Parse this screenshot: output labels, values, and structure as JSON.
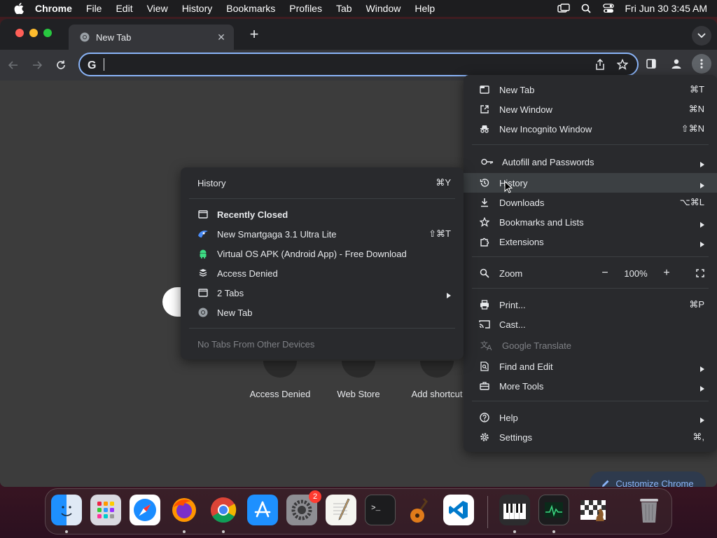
{
  "menubar": {
    "app": "Chrome",
    "items": [
      "File",
      "Edit",
      "View",
      "History",
      "Bookmarks",
      "Profiles",
      "Tab",
      "Window",
      "Help"
    ],
    "clock": "Fri Jun 30  3:45 AM"
  },
  "browser": {
    "tab_title": "New Tab",
    "omnibox_value": "",
    "shortcuts": [
      {
        "label": "Access Denied"
      },
      {
        "label": "Web Store"
      },
      {
        "label": "Add shortcut"
      }
    ],
    "customize_label": "Customize Chrome"
  },
  "main_menu": {
    "items": [
      {
        "label": "New Tab",
        "shortcut": "⌘T",
        "icon": "new-tab-icon"
      },
      {
        "label": "New Window",
        "shortcut": "⌘N",
        "icon": "new-window-icon"
      },
      {
        "label": "New Incognito Window",
        "shortcut": "⇧⌘N",
        "icon": "incognito-icon"
      },
      {
        "label": "Autofill and Passwords",
        "icon": "key-icon",
        "submenu": true
      },
      {
        "label": "History",
        "icon": "history-icon",
        "submenu": true,
        "highlighted": true
      },
      {
        "label": "Downloads",
        "shortcut": "⌥⌘L",
        "icon": "download-icon"
      },
      {
        "label": "Bookmarks and Lists",
        "icon": "star-icon",
        "submenu": true
      },
      {
        "label": "Extensions",
        "icon": "extension-icon",
        "submenu": true
      },
      {
        "label": "Zoom",
        "icon": "zoom-icon"
      },
      {
        "label": "Print...",
        "shortcut": "⌘P",
        "icon": "print-icon"
      },
      {
        "label": "Cast...",
        "icon": "cast-icon"
      },
      {
        "label": "Google Translate",
        "icon": "translate-icon",
        "disabled": true
      },
      {
        "label": "Find and Edit",
        "icon": "find-icon",
        "submenu": true
      },
      {
        "label": "More Tools",
        "icon": "toolbox-icon",
        "submenu": true
      },
      {
        "label": "Help",
        "icon": "help-icon",
        "submenu": true
      },
      {
        "label": "Settings",
        "shortcut": "⌘,",
        "icon": "settings-icon"
      }
    ],
    "zoom": {
      "minus": "−",
      "value": "100%",
      "plus": "+"
    }
  },
  "history_menu": {
    "header": {
      "label": "History",
      "shortcut": "⌘Y"
    },
    "recently_closed_label": "Recently Closed",
    "entries": [
      {
        "label": "New Smartgaga 3.1 Ultra Lite",
        "shortcut": "⇧⌘T",
        "icon": "smartgaga-icon"
      },
      {
        "label": "Virtual OS APK (Android App) - Free Download",
        "icon": "android-icon"
      },
      {
        "label": "Access Denied",
        "icon": "page-icon"
      },
      {
        "label": "2 Tabs",
        "icon": "window-icon",
        "submenu": true
      },
      {
        "label": "New Tab",
        "icon": "chrome-icon"
      }
    ],
    "footer": "No Tabs From Other Devices"
  },
  "dock": {
    "apps": [
      "Finder",
      "Launchpad",
      "Safari",
      "Firefox",
      "Chrome",
      "App Store",
      "System Settings",
      "TextEdit",
      "Terminal",
      "GarageBand",
      "VS Code",
      "Piano",
      "Activity Monitor",
      "Chess",
      "Trash"
    ],
    "settings_badge": "2"
  },
  "colors": {
    "menu_bg": "#292a2d",
    "accent": "#8ab4f8",
    "hover": "#3c4043"
  }
}
